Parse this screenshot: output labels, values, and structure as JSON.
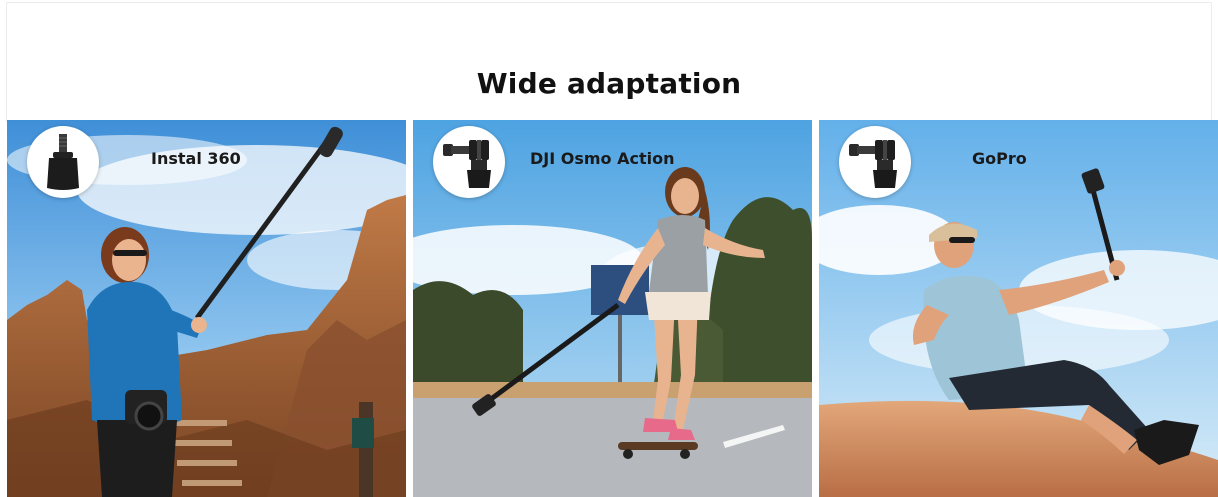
{
  "section": {
    "title": "Wide adaptation"
  },
  "panels": [
    {
      "label": "Instal 360",
      "icon": "screw-mount-icon",
      "scene": "hiker-with-selfie-stick"
    },
    {
      "label": "DJI Osmo Action",
      "icon": "gopro-mount-icon",
      "scene": "skateboarder-with-selfie-stick"
    },
    {
      "label": "GoPro",
      "icon": "gopro-mount-icon",
      "scene": "man-on-dune-with-selfie-stick"
    }
  ],
  "colors": {
    "title": "#111111",
    "label": "#1a1a1a",
    "sky": "#5aa6e4",
    "rock": "#b06a3c",
    "sand": "#d08a5c",
    "road": "#b9bcc0"
  }
}
